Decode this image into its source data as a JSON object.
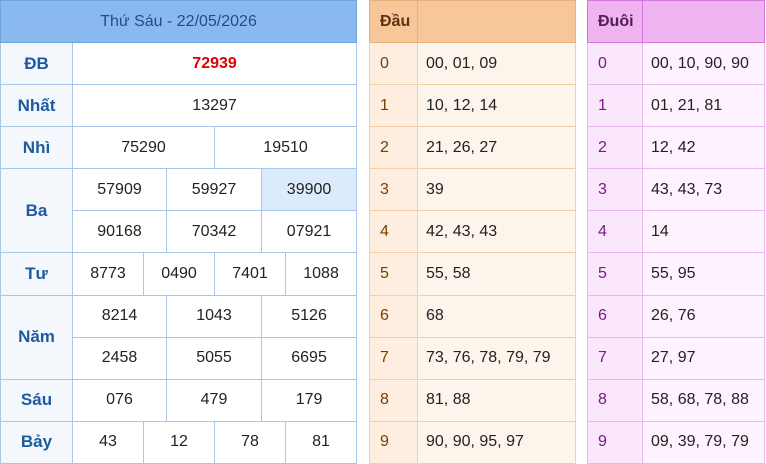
{
  "results": {
    "title": "Thứ Sáu - 22/05/2026",
    "db": {
      "label": "ĐB",
      "values": [
        "72939"
      ]
    },
    "nhat": {
      "label": "Nhất",
      "values": [
        "13297"
      ]
    },
    "nhi": {
      "label": "Nhì",
      "values": [
        "75290",
        "19510"
      ]
    },
    "ba": {
      "label": "Ba",
      "row1": [
        "57909",
        "59927",
        "39900"
      ],
      "row2": [
        "90168",
        "70342",
        "07921"
      ]
    },
    "tu": {
      "label": "Tư",
      "values": [
        "8773",
        "0490",
        "7401",
        "1088"
      ]
    },
    "nam": {
      "label": "Năm",
      "row1": [
        "8214",
        "1043",
        "5126"
      ],
      "row2": [
        "2458",
        "5055",
        "6695"
      ]
    },
    "sau": {
      "label": "Sáu",
      "values": [
        "076",
        "479",
        "179"
      ]
    },
    "bay": {
      "label": "Bảy",
      "values": [
        "43",
        "12",
        "78",
        "81"
      ]
    }
  },
  "dau": {
    "header": "Đầu",
    "rows": [
      {
        "digit": "0",
        "nums": "00, 01, 09"
      },
      {
        "digit": "1",
        "nums": "10, 12, 14"
      },
      {
        "digit": "2",
        "nums": "21, 26, 27"
      },
      {
        "digit": "3",
        "nums": "39"
      },
      {
        "digit": "4",
        "nums": "42, 43, 43"
      },
      {
        "digit": "5",
        "nums": "55, 58"
      },
      {
        "digit": "6",
        "nums": "68"
      },
      {
        "digit": "7",
        "nums": "73, 76, 78, 79, 79"
      },
      {
        "digit": "8",
        "nums": "81, 88"
      },
      {
        "digit": "9",
        "nums": "90, 90, 95, 97"
      }
    ]
  },
  "duoi": {
    "header": "Đuôi",
    "rows": [
      {
        "digit": "0",
        "nums": "00, 10, 90, 90"
      },
      {
        "digit": "1",
        "nums": "01, 21, 81"
      },
      {
        "digit": "2",
        "nums": "12, 42"
      },
      {
        "digit": "3",
        "nums": "43, 43, 73"
      },
      {
        "digit": "4",
        "nums": "14"
      },
      {
        "digit": "5",
        "nums": "55, 95"
      },
      {
        "digit": "6",
        "nums": "26, 76"
      },
      {
        "digit": "7",
        "nums": "27, 97"
      },
      {
        "digit": "8",
        "nums": "58, 68, 78, 88"
      },
      {
        "digit": "9",
        "nums": "09, 39, 79, 79"
      }
    ]
  }
}
